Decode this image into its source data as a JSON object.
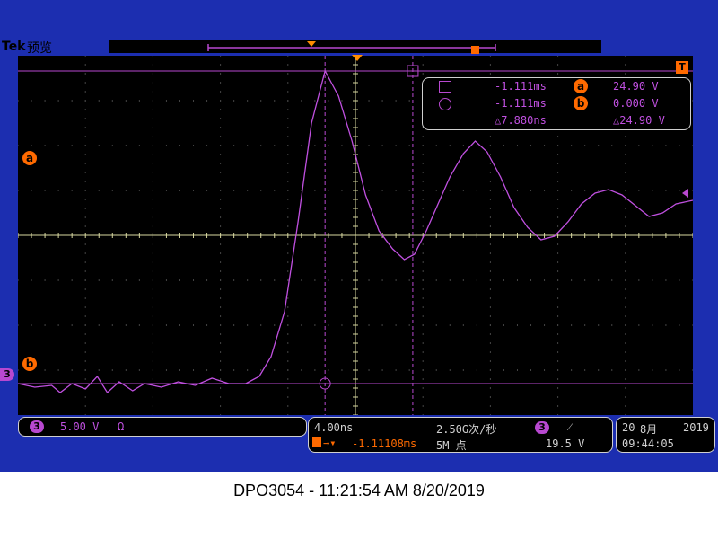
{
  "header": {
    "brand": "Tek",
    "mode_label": "预览"
  },
  "cursor_readout": {
    "row_a": {
      "time": "-1.111ms",
      "badge": "a",
      "value": "24.90 V"
    },
    "row_b": {
      "time": "-1.111ms",
      "badge": "b",
      "value": "0.000 V"
    },
    "delta": {
      "time": "△7.880ns",
      "value": "△24.90 V"
    }
  },
  "markers": {
    "trigger_position": "T",
    "cursor_a": "a",
    "cursor_b": "b",
    "channel": "3"
  },
  "channel_box": {
    "channel": "3",
    "scale": "5.00 V",
    "impedance": "Ω"
  },
  "timebase_box": {
    "horizontal_scale": "4.00ns",
    "sample_rate": "2.50G次/秒",
    "trigger_delay": "-1.11108ms",
    "record_length": "5M 点",
    "trigger_channel": "3",
    "trigger_slope": "⁄",
    "trigger_level": "19.5 V"
  },
  "datetime_box": {
    "day": "20",
    "month": "8月",
    "year": "2019",
    "time": "09:44:05"
  },
  "caption": "DPO3054 - 11:21:54 AM   8/20/2019",
  "colors": {
    "frame": "#1c2eb0",
    "waveform": "#c050e0",
    "accent": "#ff6a00",
    "grid": "#d8d8a0"
  },
  "chart_data": {
    "type": "line",
    "x_unit": "ns",
    "y_unit": "V",
    "xlim": [
      -4.0,
      36.0
    ],
    "ylim": [
      -1.75,
      18.25
    ],
    "xdiv": 10,
    "ydiv": 8,
    "cursor_a_level": 24.9,
    "cursor_b_level": 0.0,
    "series": [
      {
        "points": [
          [
            -4.0,
            0.0
          ],
          [
            -3.0,
            -0.2
          ],
          [
            -2.0,
            -0.1
          ],
          [
            -1.5,
            -0.5
          ],
          [
            -0.8,
            0.0
          ],
          [
            0.0,
            -0.3
          ],
          [
            0.7,
            0.4
          ],
          [
            1.3,
            -0.5
          ],
          [
            2.0,
            0.1
          ],
          [
            2.8,
            -0.4
          ],
          [
            3.5,
            0.0
          ],
          [
            4.5,
            -0.2
          ],
          [
            5.5,
            0.1
          ],
          [
            6.5,
            -0.1
          ],
          [
            7.5,
            0.3
          ],
          [
            8.5,
            0.0
          ],
          [
            9.5,
            0.0
          ],
          [
            10.3,
            0.4
          ],
          [
            11.0,
            1.5
          ],
          [
            11.8,
            4.0
          ],
          [
            12.6,
            9.0
          ],
          [
            13.4,
            14.5
          ],
          [
            14.2,
            17.4
          ],
          [
            15.0,
            16.0
          ],
          [
            15.8,
            13.5
          ],
          [
            16.6,
            10.5
          ],
          [
            17.4,
            8.5
          ],
          [
            18.2,
            7.5
          ],
          [
            18.9,
            6.9
          ],
          [
            19.5,
            7.2
          ],
          [
            20.2,
            8.5
          ],
          [
            20.9,
            10.0
          ],
          [
            21.6,
            11.5
          ],
          [
            22.4,
            12.8
          ],
          [
            23.1,
            13.5
          ],
          [
            23.8,
            12.9
          ],
          [
            24.6,
            11.5
          ],
          [
            25.4,
            9.8
          ],
          [
            26.2,
            8.7
          ],
          [
            27.0,
            8.0
          ],
          [
            27.8,
            8.2
          ],
          [
            28.6,
            9.0
          ],
          [
            29.4,
            10.0
          ],
          [
            30.2,
            10.6
          ],
          [
            31.0,
            10.8
          ],
          [
            31.8,
            10.5
          ],
          [
            32.6,
            9.9
          ],
          [
            33.4,
            9.3
          ],
          [
            34.2,
            9.5
          ],
          [
            35.0,
            10.0
          ],
          [
            36.0,
            10.2
          ]
        ]
      }
    ]
  }
}
